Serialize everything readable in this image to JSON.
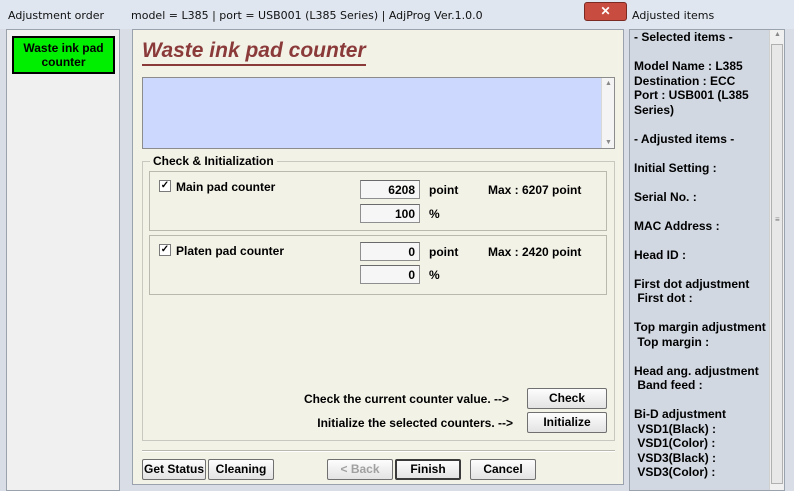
{
  "left_panel": {
    "title": "Adjustment order",
    "selected_item": "Waste ink pad counter"
  },
  "window": {
    "title": "model = L385 | port = USB001 (L385 Series) | AdjProg Ver.1.0.0",
    "close_glyph": "✕",
    "heading": "Waste ink pad counter",
    "group_title": "Check & Initialization",
    "main_pad": {
      "label": "Main pad counter",
      "checked": true,
      "check_glyph": "✓",
      "point_value": "6208",
      "point_unit": "point",
      "percent_value": "100",
      "percent_unit": "%",
      "max_label": "Max : 6207 point"
    },
    "platen_pad": {
      "label": "Platen pad counter",
      "checked": true,
      "check_glyph": "✓",
      "point_value": "0",
      "point_unit": "point",
      "percent_value": "0",
      "percent_unit": "%",
      "max_label": "Max : 2420 point"
    },
    "check_hint": "Check the current counter value. -->",
    "check_button": "Check",
    "init_hint": "Initialize the selected counters. -->",
    "init_button": "Initialize",
    "buttons": {
      "get_status": "Get Status",
      "cleaning": "Cleaning",
      "back": "< Back",
      "finish": "Finish",
      "cancel": "Cancel"
    }
  },
  "right_panel": {
    "title": "Adjusted items",
    "lines": [
      "- Selected items -",
      "",
      "Model Name : L385",
      "Destination : ECC",
      "Port : USB001 (L385",
      "Series)",
      "",
      "- Adjusted items -",
      "",
      "Initial Setting :",
      "",
      "Serial No. :",
      "",
      "MAC Address :",
      "",
      "Head ID :",
      "",
      "First dot adjustment",
      " First dot :",
      "",
      "Top margin adjustment",
      " Top margin :",
      "",
      "Head ang. adjustment",
      " Band feed :",
      "",
      "Bi-D adjustment",
      " VSD1(Black) :",
      " VSD1(Color) :",
      " VSD3(Black) :",
      " VSD3(Color) :"
    ]
  }
}
